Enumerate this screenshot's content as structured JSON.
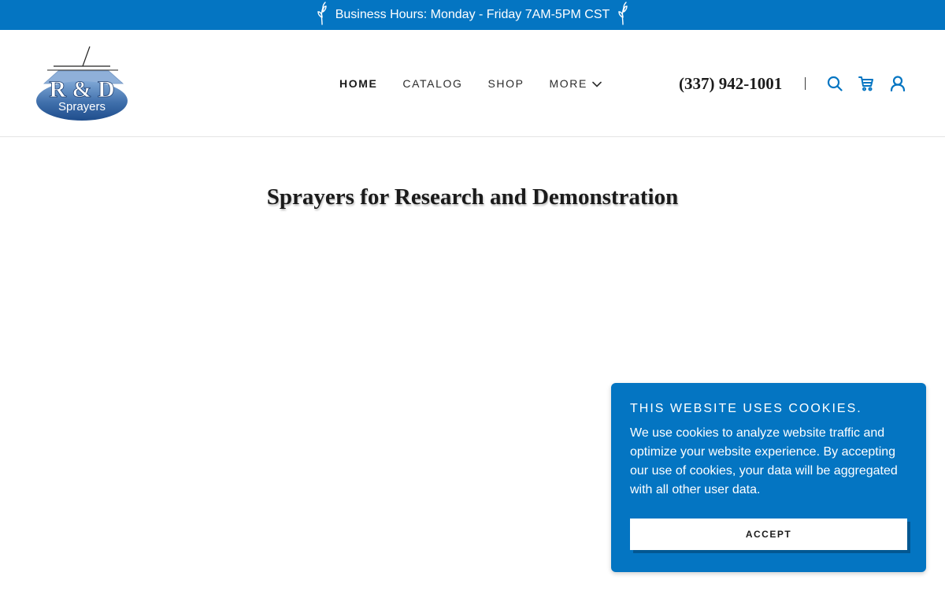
{
  "announcement": {
    "text": "Business Hours: Monday - Friday 7AM-5PM CST",
    "left_icon": "sprout-icon",
    "right_icon": "sprout-icon"
  },
  "logo": {
    "primary": "R & D",
    "secondary": "Sprayers"
  },
  "nav": {
    "items": [
      {
        "label": "HOME",
        "active": true
      },
      {
        "label": "CATALOG",
        "active": false
      },
      {
        "label": "SHOP",
        "active": false
      },
      {
        "label": "MORE",
        "active": false,
        "icon": "chevron-down-icon"
      }
    ]
  },
  "header": {
    "phone": "(337) 942-1001",
    "icons": [
      "search-icon",
      "cart-icon",
      "account-icon"
    ]
  },
  "hero": {
    "title": "Sprayers for Research and Demonstration"
  },
  "cookie_banner": {
    "title": "THIS WEBSITE USES COOKIES.",
    "text": "We use cookies to analyze website traffic and optimize your website experience. By accepting our use of cookies, your data will be aggregated with all other user data.",
    "button": "ACCEPT"
  },
  "colors": {
    "accent": "#0475c2",
    "text": "#1b1b1b",
    "background": "#ffffff"
  }
}
